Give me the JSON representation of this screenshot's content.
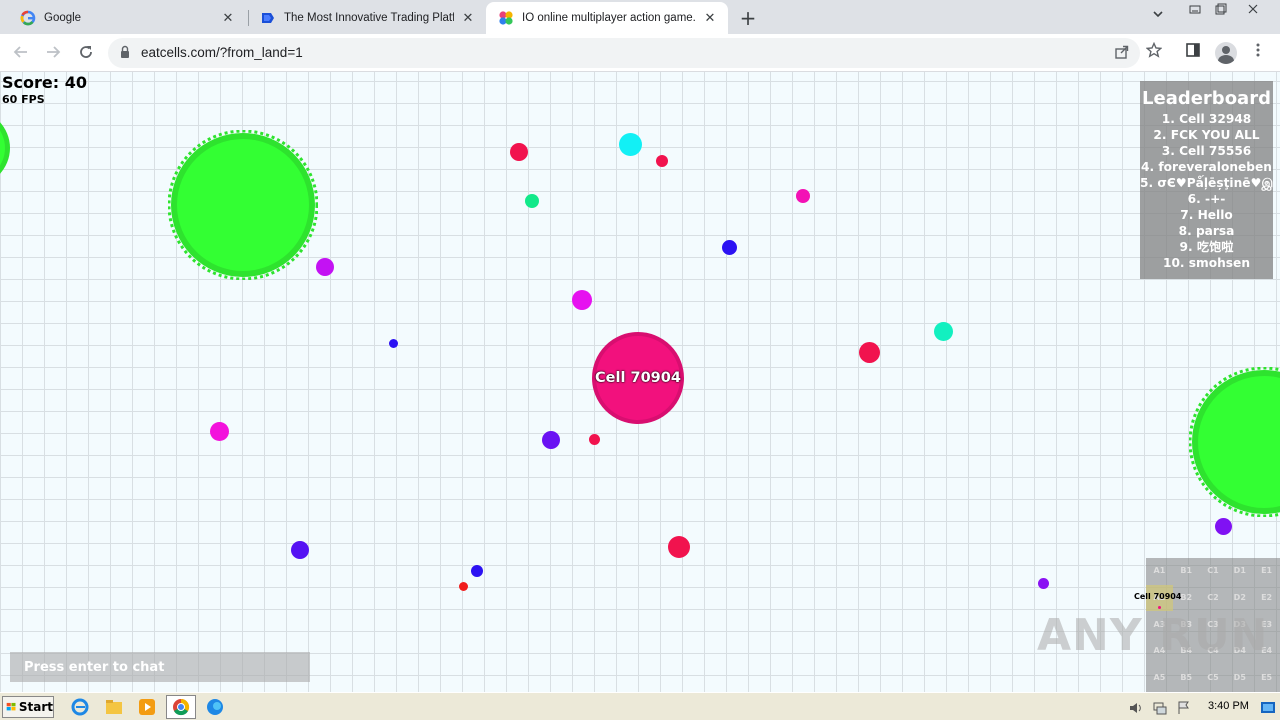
{
  "browser": {
    "tabs": [
      {
        "title": "Google",
        "favicon": "google-icon"
      },
      {
        "title": "The Most Innovative Trading Platform",
        "favicon": "trading-platform-icon"
      },
      {
        "title": "IO online multiplayer action game. S",
        "favicon": "eatcells-icon"
      }
    ],
    "new_tab": "+",
    "address": "eatcells.com/?from_land=1"
  },
  "game": {
    "score_label": "Score: 40",
    "fps_label": "60 FPS",
    "player_name": "Cell 70904",
    "chat_placeholder": "Press enter to chat",
    "leaderboard": {
      "title": "Leaderboard",
      "entries": [
        "1. Cell 32948",
        "2. FCK YOU ALL",
        "3. Cell 75556",
        "4. foreveraloneben",
        "5. σЄ♥Pǻļēșţinē♥இ",
        "6. -+-",
        "7. Hello",
        "8. parsa",
        "9. 吃饱啦",
        "10. smohsen"
      ]
    },
    "minimap": {
      "player_label": "Cell 70904",
      "cells": [
        "A1",
        "B1",
        "C1",
        "D1",
        "E1",
        "A2",
        "B2",
        "C2",
        "D2",
        "E2",
        "A3",
        "B3",
        "C3",
        "D3",
        "E3",
        "A4",
        "B4",
        "C4",
        "D4",
        "E4",
        "A5",
        "B5",
        "C5",
        "D5",
        "E5"
      ]
    },
    "colors": {
      "player": "#f2117d",
      "virus": "#33ff33"
    }
  },
  "watermark": "ANY RUN",
  "taskbar": {
    "start_label": "Start",
    "clock": "3:40 PM"
  }
}
